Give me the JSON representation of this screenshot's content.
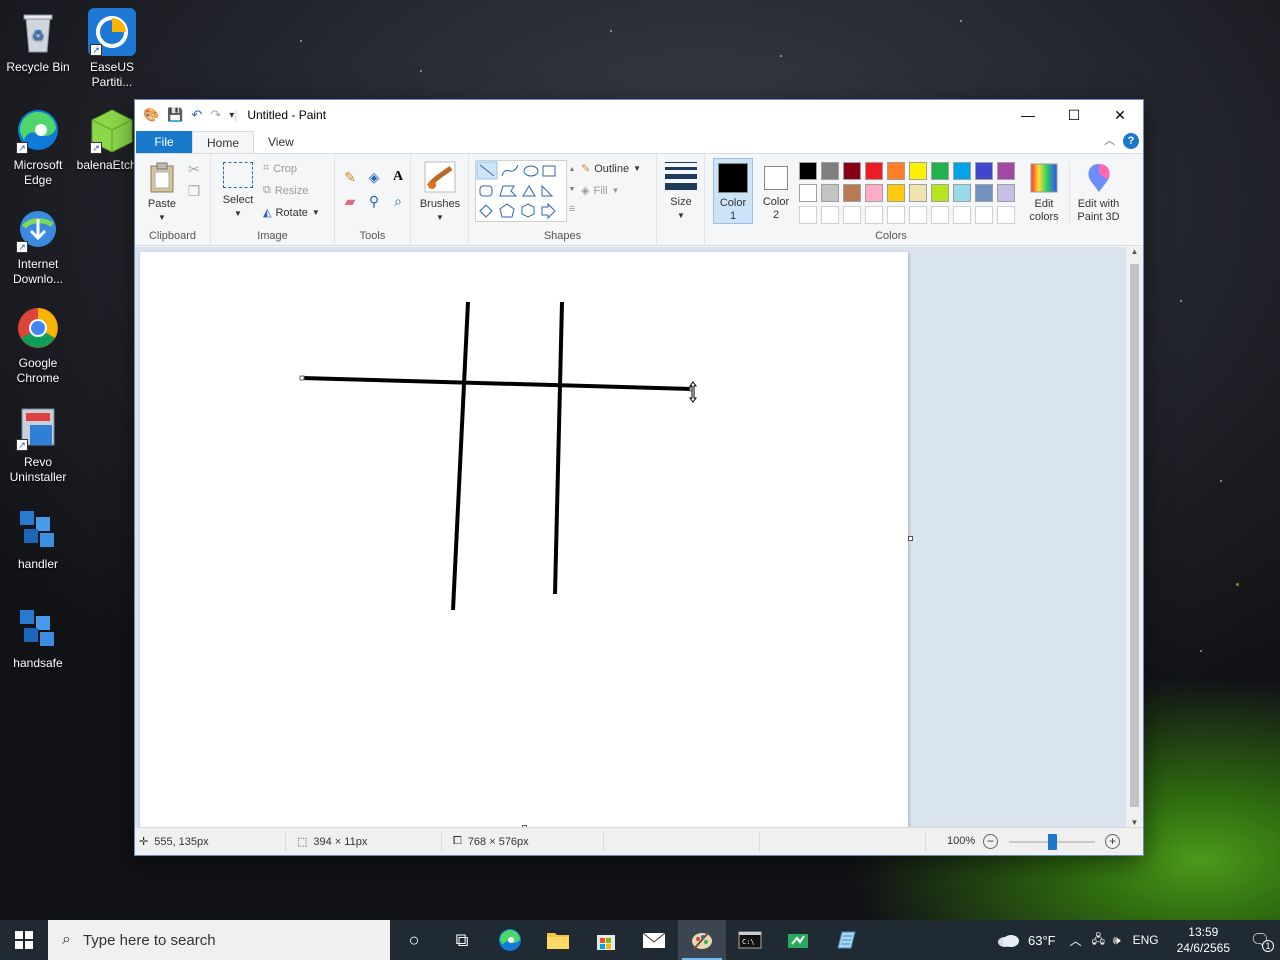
{
  "desktop": {
    "icons": [
      {
        "label": "Recycle Bin",
        "icon": "recycle-bin-icon"
      },
      {
        "label": "EaseUS Partiti...",
        "icon": "easeus-icon"
      },
      {
        "label": "Microsoft Edge",
        "icon": "edge-icon"
      },
      {
        "label": "balenaEtcher",
        "icon": "balenaetcher-icon"
      },
      {
        "label": "Internet Downlo...",
        "icon": "idm-icon"
      },
      {
        "label": "Google Chrome",
        "icon": "chrome-icon"
      },
      {
        "label": "Revo Uninstaller",
        "icon": "revo-icon"
      },
      {
        "label": "handler",
        "icon": "package-icon"
      },
      {
        "label": "handsafe",
        "icon": "package-icon"
      }
    ]
  },
  "window": {
    "title": "Untitled - Paint",
    "tabs": {
      "file": "File",
      "home": "Home",
      "view": "View"
    },
    "help": "?",
    "ribbon": {
      "clipboard": {
        "label": "Clipboard",
        "paste": "Paste"
      },
      "image": {
        "label": "Image",
        "select": "Select",
        "crop": "Crop",
        "resize": "Resize",
        "rotate": "Rotate"
      },
      "tools": {
        "label": "Tools"
      },
      "brushes": {
        "label": "Brushes"
      },
      "shapes": {
        "label": "Shapes",
        "outline": "Outline",
        "fill": "Fill"
      },
      "size": {
        "label": "Size"
      },
      "colors": {
        "label": "Colors",
        "color1": "Color\n1",
        "color1_line1": "Color",
        "color1_line2": "1",
        "color2_line1": "Color",
        "color2_line2": "2",
        "color1_value": "#000000",
        "color2_value": "#ffffff",
        "palette_row1": [
          "#000000",
          "#7f7f7f",
          "#880015",
          "#ed1c24",
          "#ff7f27",
          "#fff200",
          "#22b14c",
          "#00a2e8",
          "#3f48cc",
          "#a349a4"
        ],
        "palette_row2": [
          "#ffffff",
          "#c3c3c3",
          "#b97a57",
          "#ffaec9",
          "#ffc90e",
          "#efe4b0",
          "#b5e61d",
          "#99d9ea",
          "#7092be",
          "#c8bfe7"
        ],
        "edit_colors_line1": "Edit",
        "edit_colors_line2": "colors",
        "edit_paint3d_line1": "Edit with",
        "edit_paint3d_line2": "Paint 3D"
      }
    },
    "status": {
      "cursor_pos": "555, 135px",
      "selection_size": "394 × 11px",
      "image_size": "768 × 576px",
      "zoom": "100%",
      "zoom_level": 0.5
    }
  },
  "taskbar": {
    "search_placeholder": "Type here to search",
    "weather": "63°F",
    "language": "ENG",
    "time": "13:59",
    "date": "24/6/2565",
    "notification_count": "1"
  }
}
